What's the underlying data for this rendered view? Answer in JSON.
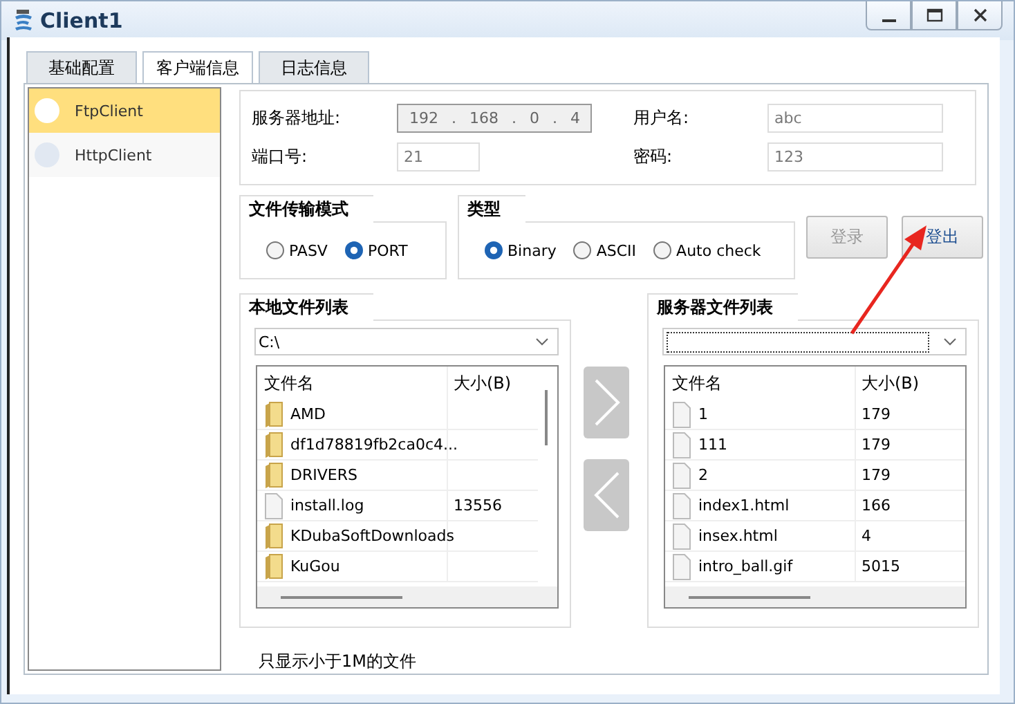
{
  "window": {
    "title": "Client1"
  },
  "tabs": [
    {
      "label": "基础配置",
      "selected": false
    },
    {
      "label": "客户端信息",
      "selected": true
    },
    {
      "label": "日志信息",
      "selected": false
    }
  ],
  "sidebar": {
    "items": [
      {
        "label": "FtpClient",
        "selected": true
      },
      {
        "label": "HttpClient",
        "selected": false
      }
    ]
  },
  "server": {
    "address_label": "服务器地址:",
    "ip": "192 . 168 . 0 . 4",
    "username_label": "用户名:",
    "username": "abc",
    "port_label": "端口号:",
    "port": "21",
    "password_label": "密码:",
    "password": "123"
  },
  "transfer_mode": {
    "title": "文件传输模式",
    "options": [
      {
        "label": "PASV",
        "selected": false
      },
      {
        "label": "PORT",
        "selected": true
      }
    ]
  },
  "type": {
    "title": "类型",
    "options": [
      {
        "label": "Binary",
        "selected": true
      },
      {
        "label": "ASCII",
        "selected": false
      },
      {
        "label": "Auto check",
        "selected": false
      }
    ]
  },
  "buttons": [
    {
      "label": "登录",
      "disabled": true
    },
    {
      "label": "登出",
      "disabled": false
    }
  ],
  "local_files": {
    "title": "本地文件列表",
    "path": "C:\\",
    "columns": [
      "文件名",
      "大小(B)"
    ],
    "rows": [
      {
        "kind": "folder",
        "name": "AMD"
      },
      {
        "kind": "folder",
        "name": "df1d78819fb2ca0c4..."
      },
      {
        "kind": "folder",
        "name": "DRIVERS"
      },
      {
        "kind": "file",
        "name": "install.log",
        "size": "13556"
      },
      {
        "kind": "folder",
        "name": "KDubaSoftDownloads"
      },
      {
        "kind": "folder",
        "name": "KuGou"
      }
    ]
  },
  "server_files": {
    "title": "服务器文件列表",
    "columns": [
      "文件名",
      "大小(B)"
    ],
    "rows": [
      {
        "kind": "file",
        "name": "1",
        "size": "179"
      },
      {
        "kind": "file",
        "name": "111",
        "size": "179"
      },
      {
        "kind": "file",
        "name": "2",
        "size": "179"
      },
      {
        "kind": "file",
        "name": "index1.html",
        "size": "166"
      },
      {
        "kind": "file",
        "name": "insex.html",
        "size": "4"
      },
      {
        "kind": "file",
        "name": "intro_ball.gif",
        "size": "5015"
      }
    ]
  },
  "note": "只显示小于1M的文件"
}
